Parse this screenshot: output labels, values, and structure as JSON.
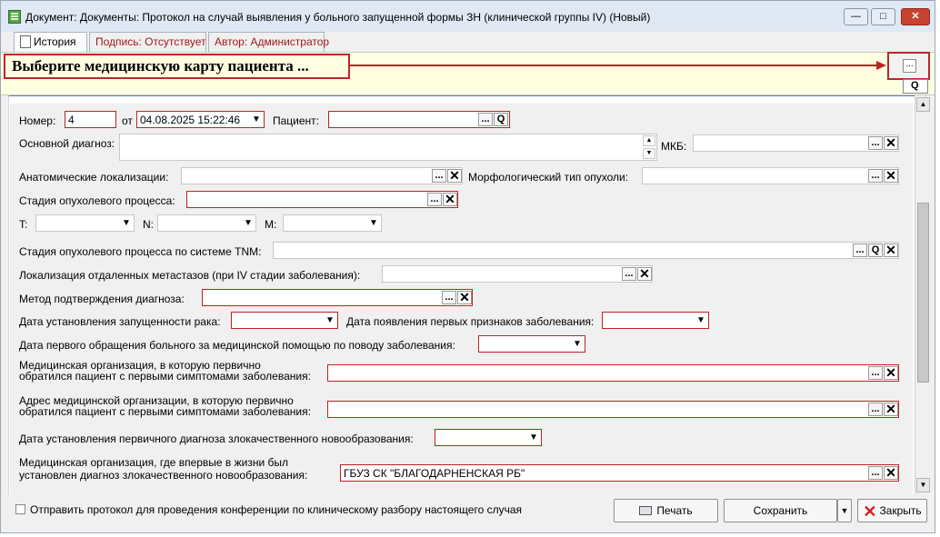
{
  "window": {
    "title": "Документ: Документы: Протокол на случай выявления у больного запущенной формы ЗН (клинической группы IV) (Новый)",
    "buttons": {
      "minimize": "—",
      "maximize": "□",
      "close": "✕"
    }
  },
  "tabs": [
    {
      "label": "История"
    },
    {
      "label": "Подпись: Отсутствует"
    },
    {
      "label": "Автор: Администратор"
    }
  ],
  "header": {
    "select_card_text": "Выберите медицинскую карту пациента ...",
    "dots": "...",
    "search_symbol": "Q"
  },
  "form": {
    "number_label": "Номер:",
    "number_value": "4",
    "date_label": "от",
    "date_value": "04.08.2025 15:22:46",
    "patient_label": "Пациент:",
    "diagnosis_label": "Основной диагноз:",
    "mkb_label": "МКБ:",
    "anat_label": "Анатомические локализации:",
    "morph_label": "Морфологический тип опухоли:",
    "stage_label": "Стадия опухолевого процесса:",
    "t_label": "T:",
    "n_label": "N:",
    "m_label": "M:",
    "tnm_label": "Стадия опухолевого процесса по системе TNM:",
    "metastases_label": "Локализация отдаленных метастазов (при IV стадии заболевания):",
    "method_label": "Метод подтверждения диагноза:",
    "date_neglect_label": "Дата установления запущенности рака:",
    "date_first_signs_label": "Дата появления первых признаков заболевания:",
    "date_first_visit_label": "Дата первого обращения больного за медицинской помощью по поводу заболевания:",
    "org_first_label_line1": "Медицинская организация, в которую первично",
    "org_first_label_line2": "обратился пациент с первыми симптомами заболевания:",
    "addr_first_label_line1": "Адрес медицинской организации, в которую первично",
    "addr_first_label_line2": "обратился пациент с первыми симптомами заболевания:",
    "date_primary_diag_label": "Дата установления первичного диагноза злокачественного новообразования:",
    "org_diag_label_line1": "Медицинская организация, где впервые в жизни был",
    "org_diag_label_line2": "установлен диагноз злокачественного новообразования:",
    "org_diag_value": "ГБУЗ СК \"БЛАГОДАРНЕНСКАЯ РБ\""
  },
  "footer": {
    "checkbox_label": "Отправить протокол для проведения конференции по клиническому разбору настоящего случая",
    "print_label": "Печать",
    "save_label": "Сохранить",
    "close_label": "Закрыть"
  },
  "colors": {
    "required_border": "#c21f22",
    "header_background": "#ffffe1",
    "title_bar": "#dfe8f3",
    "accent_blue": "#5f86b4"
  },
  "icons": [
    "document-icon",
    "history-icon",
    "ellipsis-icon",
    "search-icon",
    "clear-icon",
    "dropdown-arrow-icon",
    "printer-icon",
    "close-red-x-icon"
  ]
}
